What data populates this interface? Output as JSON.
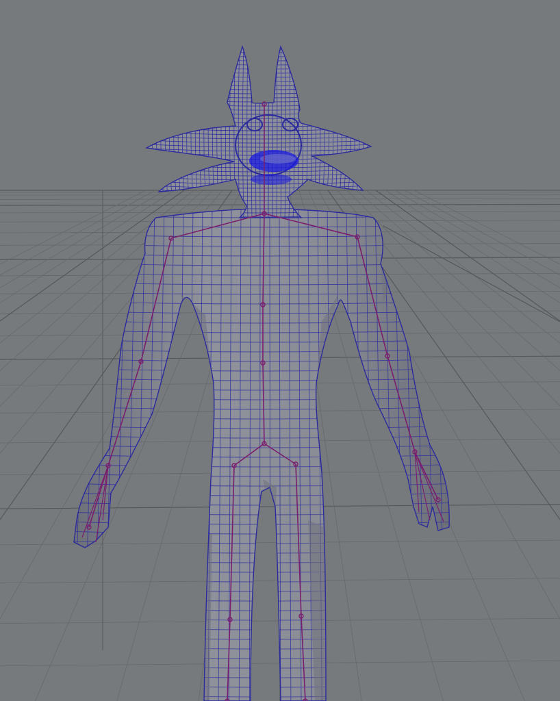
{
  "viewport": {
    "background_color": "#777a7d",
    "grid_color": "#66686b",
    "grid_major_color": "#55575a",
    "mesh_fill_color": "#8d8f98",
    "mesh_shadow_color": "#6f717c",
    "wire_color": "#2b2b9c",
    "joint_color": "#7a1f6e",
    "selection_highlight_color": "#1a1ae0"
  },
  "scene": {
    "model": "character-mesh",
    "skeleton": "joint-chain",
    "view": "perspective"
  }
}
